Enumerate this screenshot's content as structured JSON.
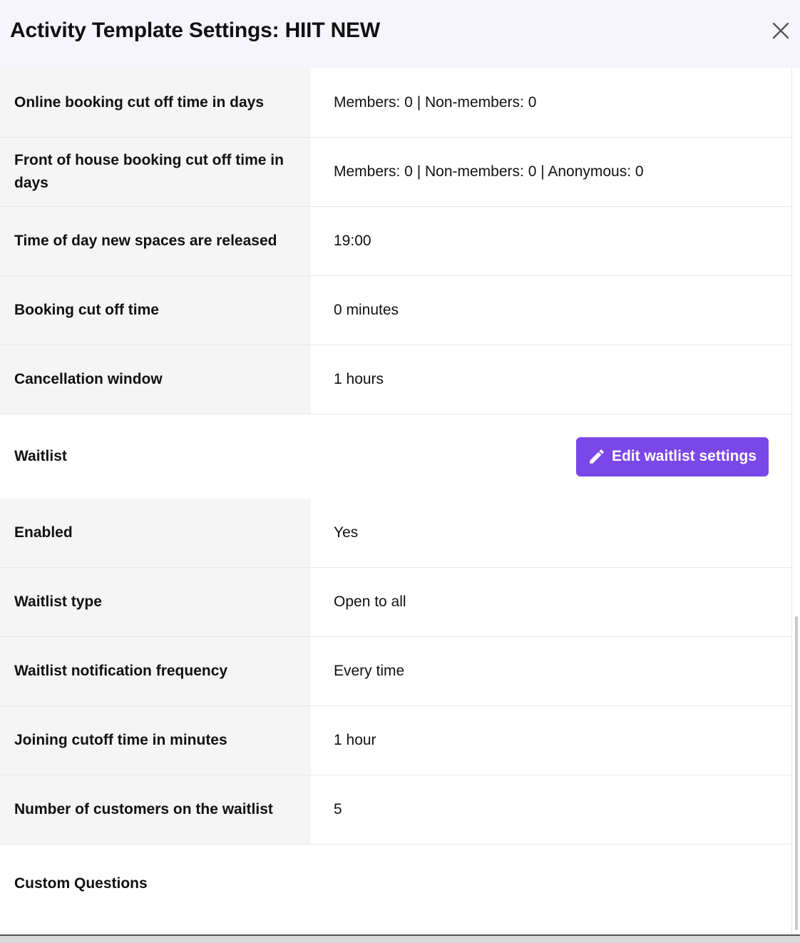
{
  "header": {
    "title": "Activity Template Settings: HIIT NEW",
    "close_icon": "close-icon"
  },
  "booking_rows": [
    {
      "label": "Online booking cut off time in days",
      "value": "Members: 0 | Non-members: 0"
    },
    {
      "label": "Front of house booking cut off time in days",
      "value": "Members: 0 | Non-members: 0 | Anonymous: 0"
    },
    {
      "label": "Time of day new spaces are released",
      "value": "19:00"
    },
    {
      "label": "Booking cut off time",
      "value": "0 minutes"
    },
    {
      "label": "Cancellation window",
      "value": "1 hours"
    }
  ],
  "waitlist": {
    "title": "Waitlist",
    "edit_button_label": "Edit waitlist settings",
    "edit_button_icon": "pencil-icon",
    "accent_color": "#7b47e8",
    "rows": [
      {
        "label": "Enabled",
        "value": "Yes"
      },
      {
        "label": "Waitlist type",
        "value": "Open to all"
      },
      {
        "label": "Waitlist notification frequency",
        "value": "Every time"
      },
      {
        "label": "Joining cutoff time in minutes",
        "value": "1 hour"
      },
      {
        "label": "Number of customers on the waitlist",
        "value": "5"
      }
    ]
  },
  "custom_questions": {
    "title": "Custom Questions"
  }
}
